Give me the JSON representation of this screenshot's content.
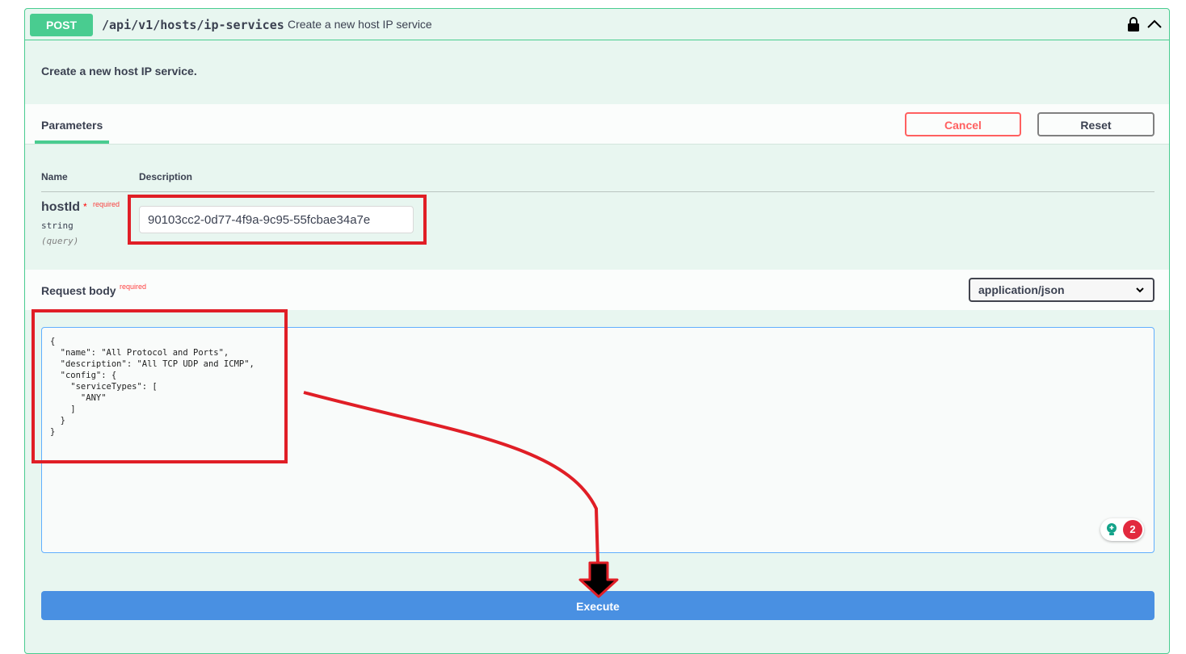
{
  "operation": {
    "method": "POST",
    "path": "/api/v1/hosts/ip-services",
    "summary": "Create a new host IP service",
    "description": "Create a new host IP service.",
    "icons": [
      "lock-icon",
      "chevron-up-icon"
    ]
  },
  "parameters": {
    "tab_label": "Parameters",
    "cancel_label": "Cancel",
    "reset_label": "Reset",
    "col_name": "Name",
    "col_description": "Description",
    "items": [
      {
        "name": "hostId",
        "required_star": "*",
        "required_label": "required",
        "type": "string",
        "in": "(query)",
        "value": "90103cc2-0d77-4f9a-9c95-55fcbae34a7e"
      }
    ]
  },
  "request_body": {
    "title": "Request body",
    "required_label": "required",
    "content_type": "application/json",
    "code_lines": [
      "{",
      "  \"name\": \"All Protocol and Ports\",",
      "  \"description\": \"All TCP UDP and ICMP\",",
      "  \"config\": {",
      "    \"serviceTypes\": [",
      "      \"ANY\"",
      "    ]",
      "  }",
      "}"
    ],
    "badge_count": "2"
  },
  "execute_label": "Execute",
  "colors": {
    "post_green": "#49cc90",
    "block_bg": "#e8f6f0",
    "execute_blue": "#4990e2",
    "cancel_red": "#ff6060",
    "annotation_red": "#e01e26"
  }
}
